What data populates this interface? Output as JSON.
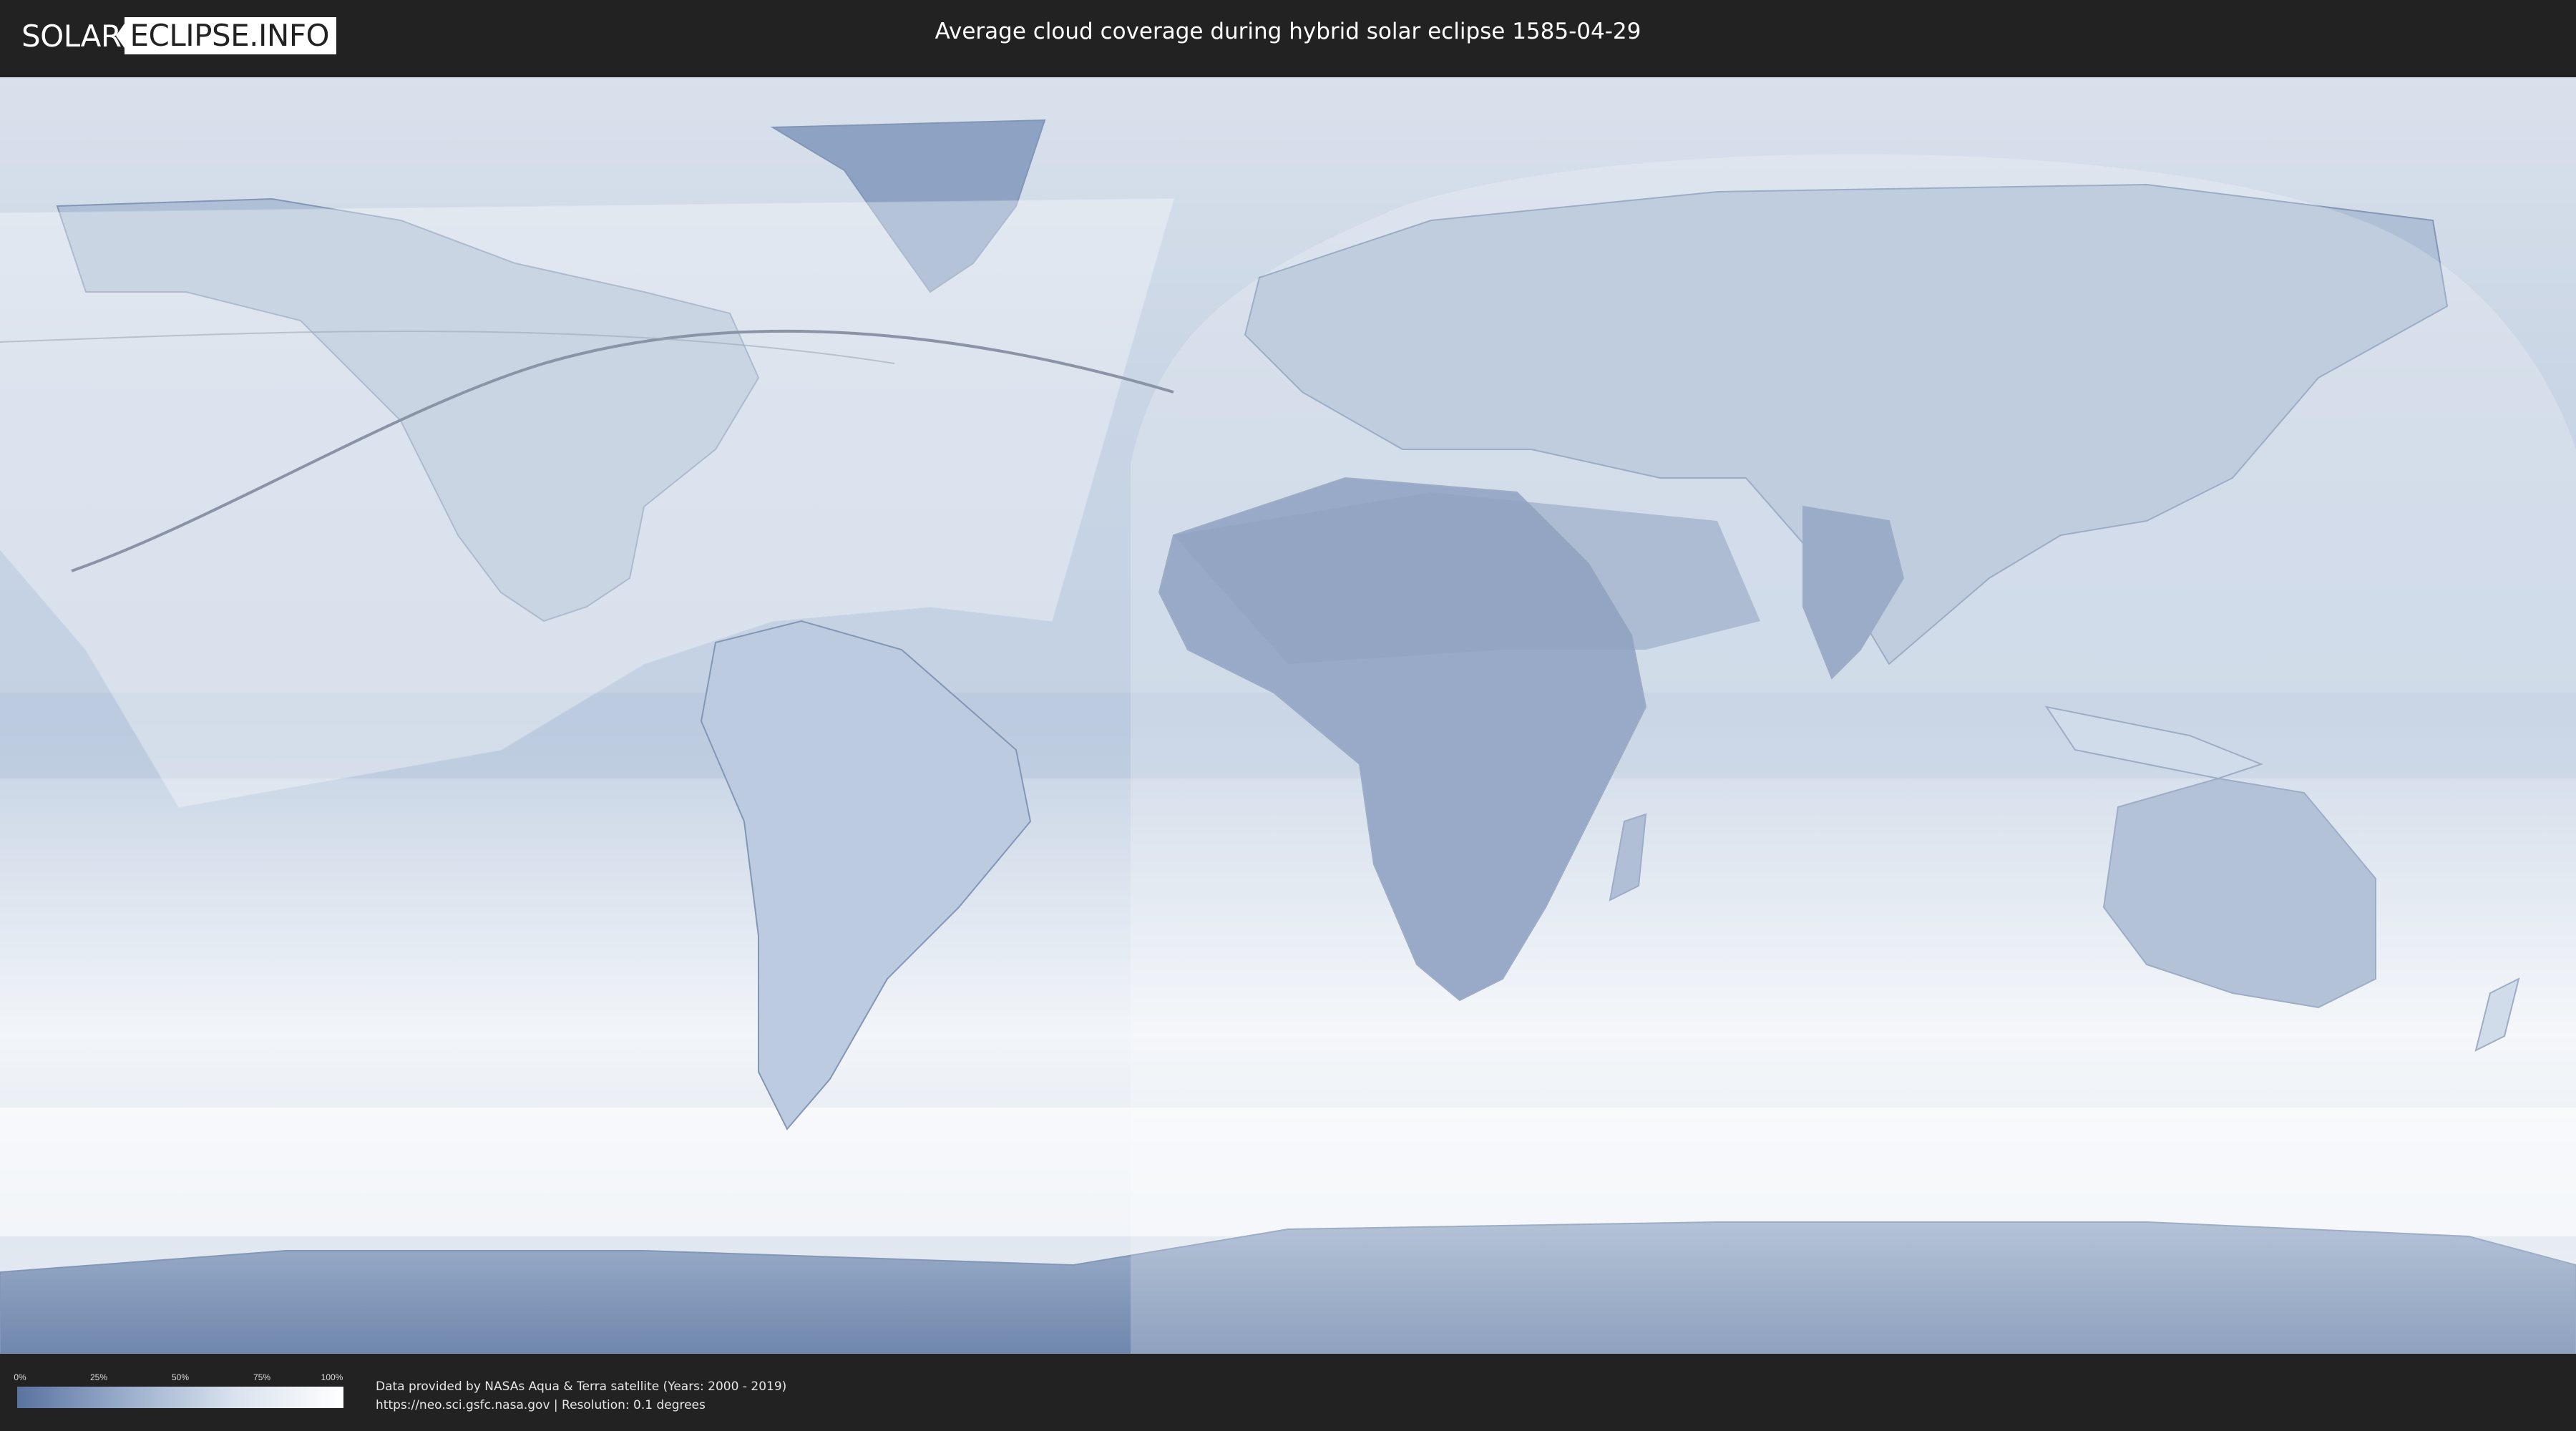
{
  "header": {
    "logo": {
      "part1": "SOLAR",
      "part2": "ECLIPSE.INFO"
    },
    "title": "Average cloud coverage during hybrid solar eclipse 1585-04-29"
  },
  "map": {
    "icon": "world-map-icon",
    "colors": {
      "clear": "#5a73a0",
      "cloudy": "#ffffff",
      "background": "#222222"
    }
  },
  "legend": {
    "ticks": [
      "0%",
      "25%",
      "50%",
      "75%",
      "100%"
    ]
  },
  "footer": {
    "line1": "Data provided by NASAs Aqua & Terra satellite (Years: 2000 - 2019)",
    "line2": "https://neo.sci.gsfc.nasa.gov | Resolution: 0.1 degrees"
  }
}
